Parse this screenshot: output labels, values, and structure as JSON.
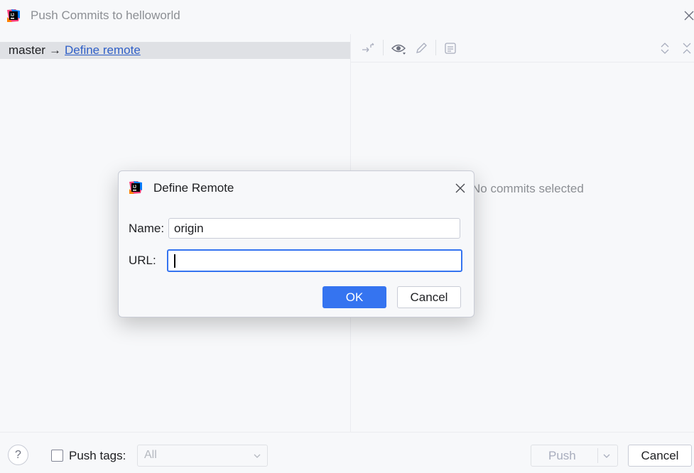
{
  "window": {
    "title": "Push Commits to helloworld",
    "close_icon": "close-icon",
    "logo_icon": "intellij-logo-icon"
  },
  "push_tree": {
    "branch": "master",
    "arrow": "→",
    "remote_link": "Define remote"
  },
  "details": {
    "toolbar_icons": [
      "collapse-icon",
      "eye-icon",
      "pencil-icon",
      "diff-icon",
      "expand-all-icon",
      "collapse-all-icon"
    ],
    "empty_text": "No commits selected"
  },
  "bottom": {
    "help_label": "?",
    "push_tags_label": "Push tags:",
    "push_tags_checked": false,
    "tags_value": "All",
    "push_label": "Push",
    "cancel_label": "Cancel"
  },
  "dialog": {
    "title": "Define Remote",
    "name_label": "Name:",
    "name_value": "origin",
    "url_label": "URL:",
    "url_value": "",
    "ok_label": "OK",
    "cancel_label": "Cancel"
  },
  "colors": {
    "accent": "#3574f0",
    "link": "#2f5fc7",
    "selection": "#dfe1e5",
    "muted": "#8c8f94"
  }
}
